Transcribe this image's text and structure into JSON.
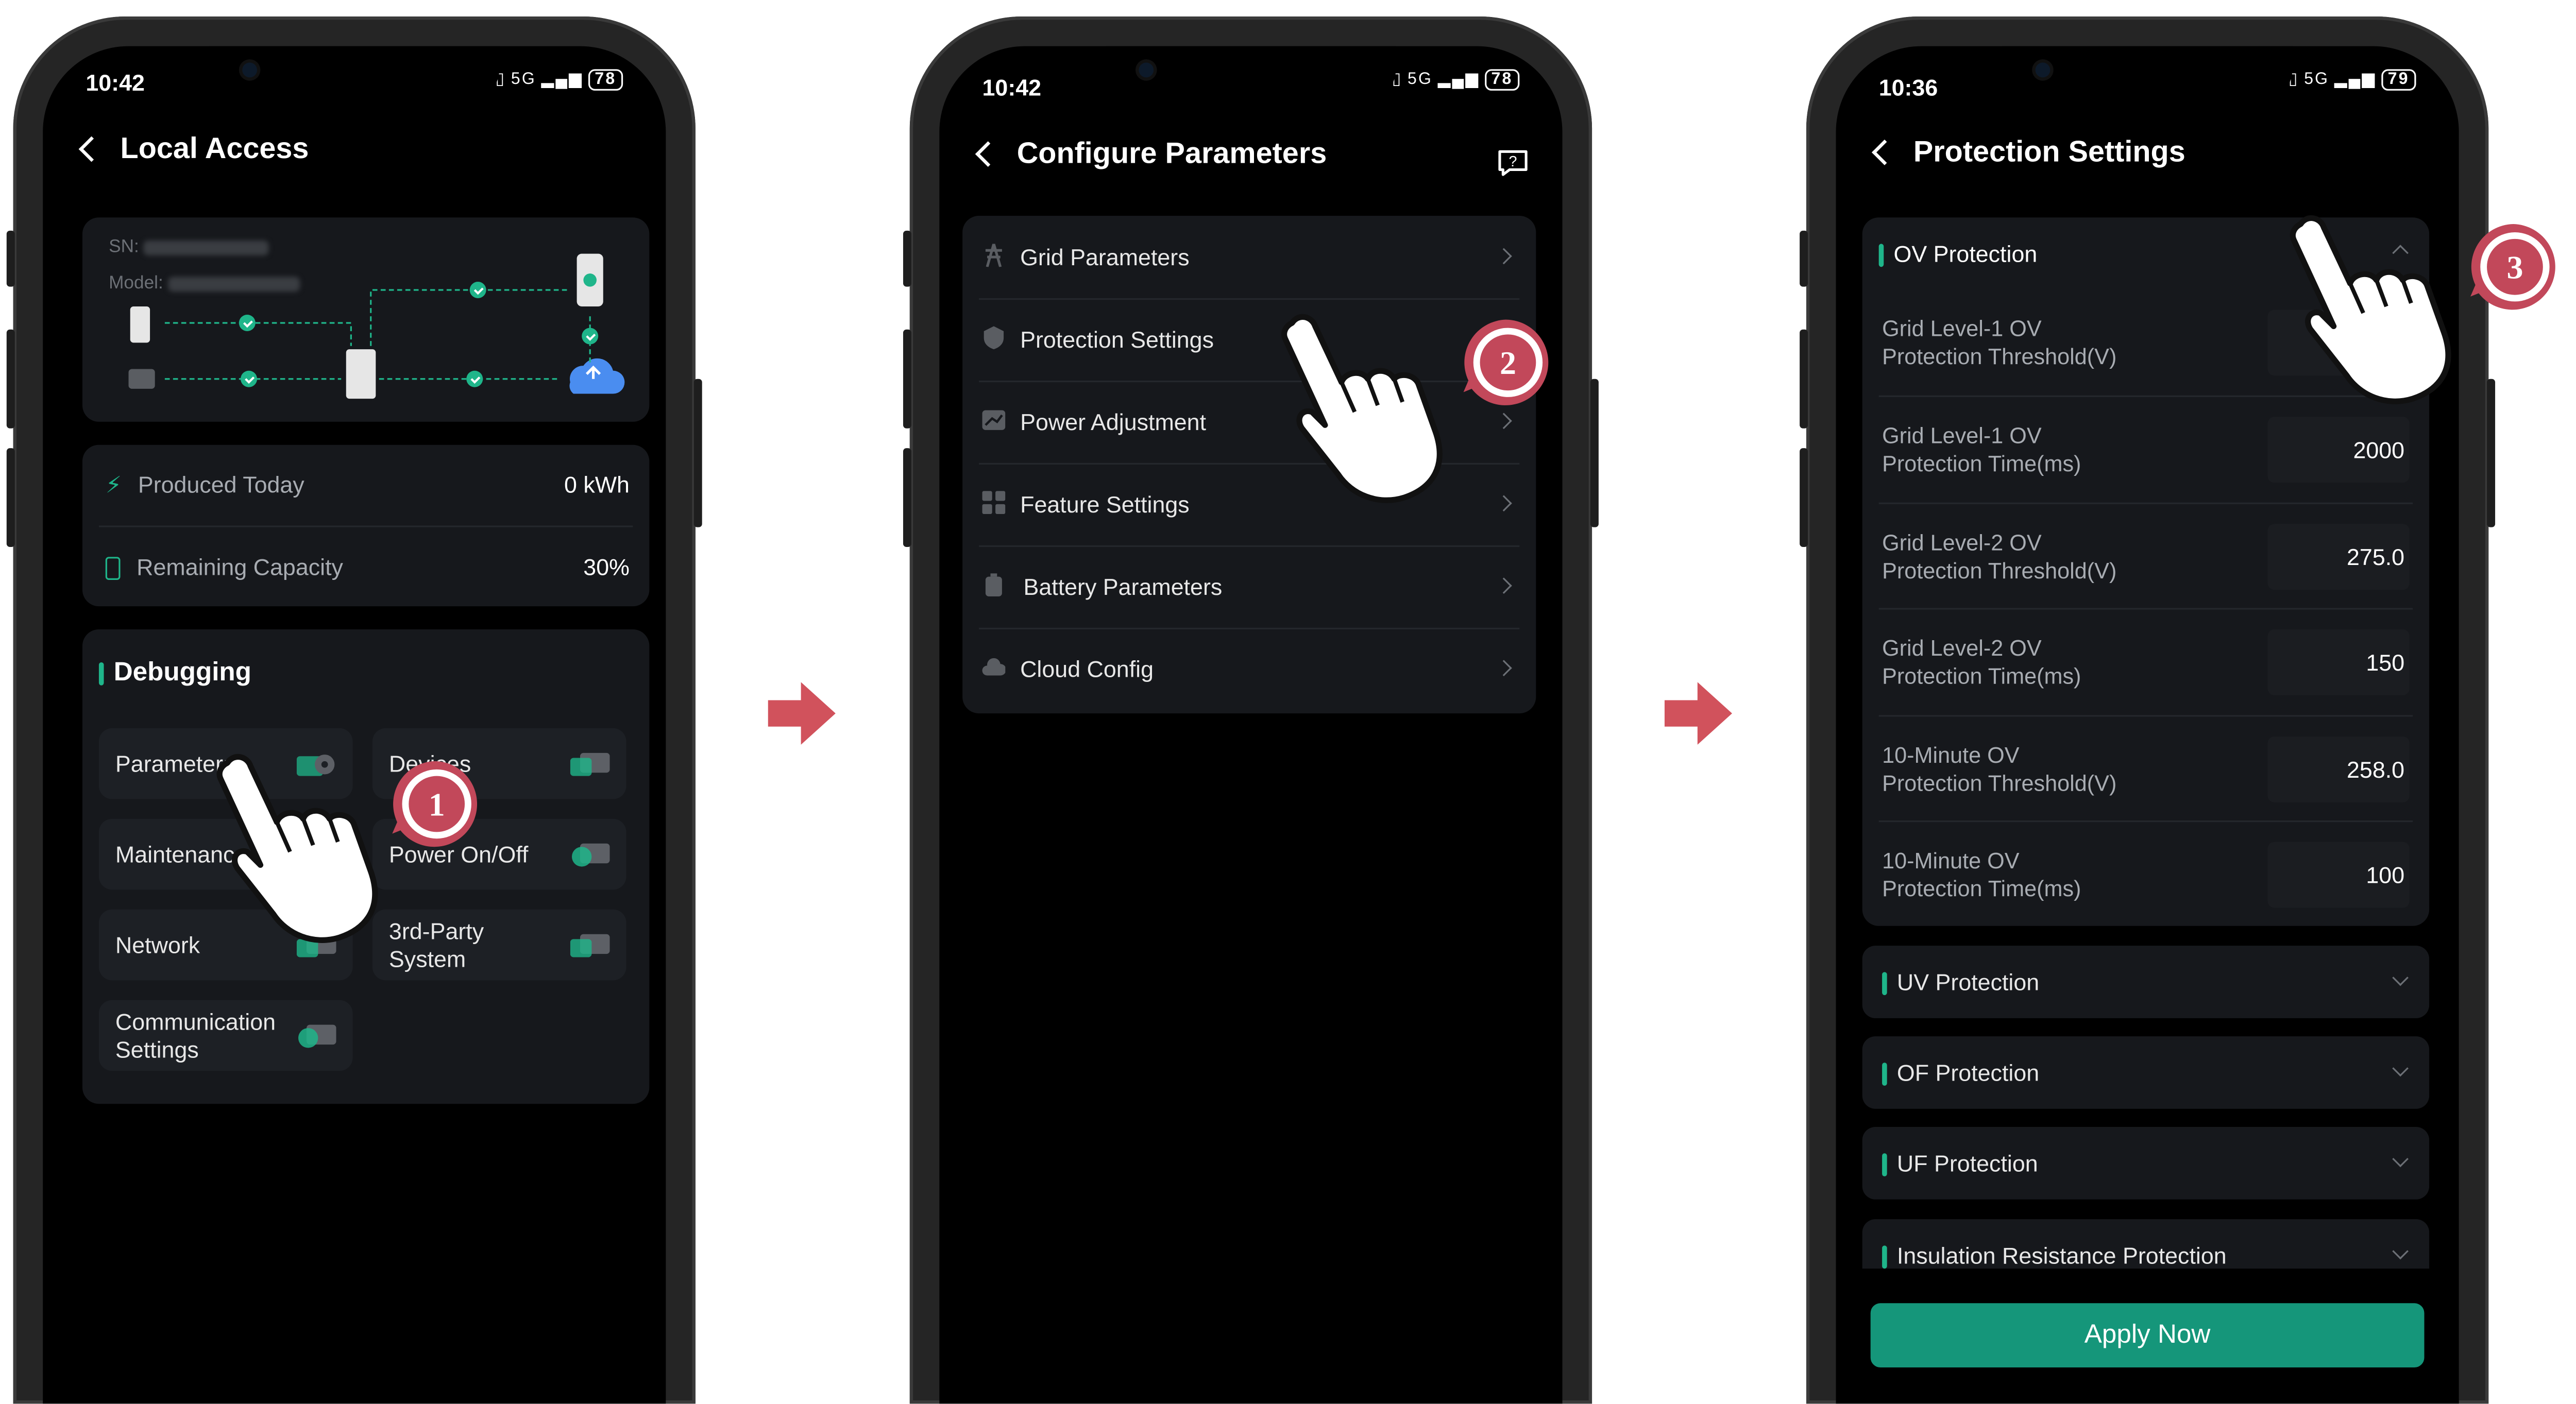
{
  "colors": {
    "accent": "#1fb58a",
    "apply_button": "#15967a",
    "badge": "#c2485a",
    "background": "#000000",
    "card": "#16181c"
  },
  "screen1": {
    "status": {
      "time": "10:42",
      "battery": "78",
      "network": "5G"
    },
    "title": "Local Access",
    "device": {
      "sn_label": "SN:",
      "model_label": "Model:"
    },
    "stats": [
      {
        "label": "Produced Today",
        "value": "0 kWh",
        "icon": "lightning-icon"
      },
      {
        "label": "Remaining Capacity",
        "value": "30%",
        "icon": "battery-icon"
      }
    ],
    "debugging": {
      "title": "Debugging",
      "tiles": [
        {
          "label": "Parameters",
          "icon": "parameters-icon"
        },
        {
          "label": "Devices",
          "icon": "devices-icon"
        },
        {
          "label": "Maintenance",
          "icon": "maintenance-icon"
        },
        {
          "label": "Power On/Off",
          "icon": "power-icon"
        },
        {
          "label": "Network",
          "icon": "network-icon"
        },
        {
          "label": "3rd-Party System",
          "icon": "third-party-icon"
        },
        {
          "label": "Communication Settings",
          "icon": "communication-icon"
        }
      ]
    },
    "step": "1"
  },
  "screen2": {
    "status": {
      "time": "10:42",
      "battery": "78",
      "network": "5G"
    },
    "title": "Configure Parameters",
    "items": [
      {
        "label": "Grid Parameters",
        "icon": "grid-tower-icon"
      },
      {
        "label": "Protection Settings",
        "icon": "shield-icon"
      },
      {
        "label": "Power Adjustment",
        "icon": "chart-icon"
      },
      {
        "label": "Feature Settings",
        "icon": "grid-squares-icon"
      },
      {
        "label": "Battery Parameters",
        "icon": "battery-icon"
      },
      {
        "label": "Cloud Config",
        "icon": "cloud-icon"
      }
    ],
    "step": "2"
  },
  "screen3": {
    "status": {
      "time": "10:36",
      "battery": "79",
      "network": "5G"
    },
    "title": "Protection Settings",
    "ov": {
      "title": "OV Protection",
      "rows": [
        {
          "label1": "Grid Level-1 OV",
          "label2": "Protection Threshold(V)",
          "value": ""
        },
        {
          "label1": "Grid Level-1 OV",
          "label2": "Protection Time(ms)",
          "value": "2000"
        },
        {
          "label1": "Grid Level-2 OV",
          "label2": "Protection Threshold(V)",
          "value": "275.0"
        },
        {
          "label1": "Grid Level-2 OV",
          "label2": "Protection Time(ms)",
          "value": "150"
        },
        {
          "label1": "10-Minute OV",
          "label2": "Protection Threshold(V)",
          "value": "258.0"
        },
        {
          "label1": "10-Minute OV",
          "label2": "Protection Time(ms)",
          "value": "100"
        }
      ]
    },
    "sections": [
      "UV Protection",
      "OF Protection",
      "UF Protection",
      "Insulation Resistance Protection"
    ],
    "apply_label": "Apply Now",
    "step": "3"
  }
}
